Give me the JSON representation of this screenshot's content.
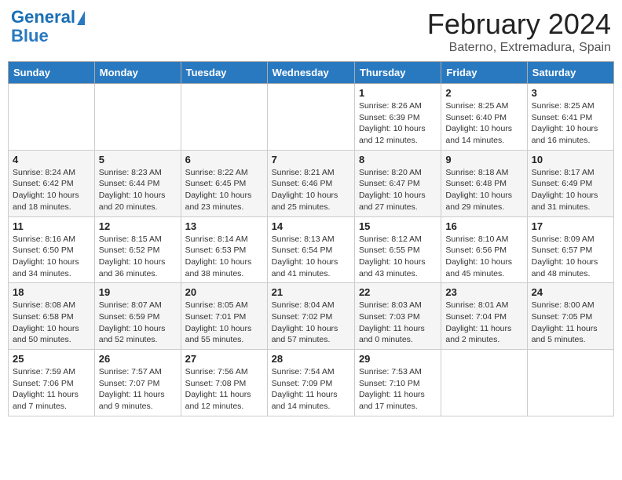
{
  "header": {
    "logo_line1": "General",
    "logo_line2": "Blue",
    "title": "February 2024",
    "subtitle": "Baterno, Extremadura, Spain"
  },
  "weekdays": [
    "Sunday",
    "Monday",
    "Tuesday",
    "Wednesday",
    "Thursday",
    "Friday",
    "Saturday"
  ],
  "weeks": [
    [
      {
        "day": "",
        "info": ""
      },
      {
        "day": "",
        "info": ""
      },
      {
        "day": "",
        "info": ""
      },
      {
        "day": "",
        "info": ""
      },
      {
        "day": "1",
        "info": "Sunrise: 8:26 AM\nSunset: 6:39 PM\nDaylight: 10 hours\nand 12 minutes."
      },
      {
        "day": "2",
        "info": "Sunrise: 8:25 AM\nSunset: 6:40 PM\nDaylight: 10 hours\nand 14 minutes."
      },
      {
        "day": "3",
        "info": "Sunrise: 8:25 AM\nSunset: 6:41 PM\nDaylight: 10 hours\nand 16 minutes."
      }
    ],
    [
      {
        "day": "4",
        "info": "Sunrise: 8:24 AM\nSunset: 6:42 PM\nDaylight: 10 hours\nand 18 minutes."
      },
      {
        "day": "5",
        "info": "Sunrise: 8:23 AM\nSunset: 6:44 PM\nDaylight: 10 hours\nand 20 minutes."
      },
      {
        "day": "6",
        "info": "Sunrise: 8:22 AM\nSunset: 6:45 PM\nDaylight: 10 hours\nand 23 minutes."
      },
      {
        "day": "7",
        "info": "Sunrise: 8:21 AM\nSunset: 6:46 PM\nDaylight: 10 hours\nand 25 minutes."
      },
      {
        "day": "8",
        "info": "Sunrise: 8:20 AM\nSunset: 6:47 PM\nDaylight: 10 hours\nand 27 minutes."
      },
      {
        "day": "9",
        "info": "Sunrise: 8:18 AM\nSunset: 6:48 PM\nDaylight: 10 hours\nand 29 minutes."
      },
      {
        "day": "10",
        "info": "Sunrise: 8:17 AM\nSunset: 6:49 PM\nDaylight: 10 hours\nand 31 minutes."
      }
    ],
    [
      {
        "day": "11",
        "info": "Sunrise: 8:16 AM\nSunset: 6:50 PM\nDaylight: 10 hours\nand 34 minutes."
      },
      {
        "day": "12",
        "info": "Sunrise: 8:15 AM\nSunset: 6:52 PM\nDaylight: 10 hours\nand 36 minutes."
      },
      {
        "day": "13",
        "info": "Sunrise: 8:14 AM\nSunset: 6:53 PM\nDaylight: 10 hours\nand 38 minutes."
      },
      {
        "day": "14",
        "info": "Sunrise: 8:13 AM\nSunset: 6:54 PM\nDaylight: 10 hours\nand 41 minutes."
      },
      {
        "day": "15",
        "info": "Sunrise: 8:12 AM\nSunset: 6:55 PM\nDaylight: 10 hours\nand 43 minutes."
      },
      {
        "day": "16",
        "info": "Sunrise: 8:10 AM\nSunset: 6:56 PM\nDaylight: 10 hours\nand 45 minutes."
      },
      {
        "day": "17",
        "info": "Sunrise: 8:09 AM\nSunset: 6:57 PM\nDaylight: 10 hours\nand 48 minutes."
      }
    ],
    [
      {
        "day": "18",
        "info": "Sunrise: 8:08 AM\nSunset: 6:58 PM\nDaylight: 10 hours\nand 50 minutes."
      },
      {
        "day": "19",
        "info": "Sunrise: 8:07 AM\nSunset: 6:59 PM\nDaylight: 10 hours\nand 52 minutes."
      },
      {
        "day": "20",
        "info": "Sunrise: 8:05 AM\nSunset: 7:01 PM\nDaylight: 10 hours\nand 55 minutes."
      },
      {
        "day": "21",
        "info": "Sunrise: 8:04 AM\nSunset: 7:02 PM\nDaylight: 10 hours\nand 57 minutes."
      },
      {
        "day": "22",
        "info": "Sunrise: 8:03 AM\nSunset: 7:03 PM\nDaylight: 11 hours\nand 0 minutes."
      },
      {
        "day": "23",
        "info": "Sunrise: 8:01 AM\nSunset: 7:04 PM\nDaylight: 11 hours\nand 2 minutes."
      },
      {
        "day": "24",
        "info": "Sunrise: 8:00 AM\nSunset: 7:05 PM\nDaylight: 11 hours\nand 5 minutes."
      }
    ],
    [
      {
        "day": "25",
        "info": "Sunrise: 7:59 AM\nSunset: 7:06 PM\nDaylight: 11 hours\nand 7 minutes."
      },
      {
        "day": "26",
        "info": "Sunrise: 7:57 AM\nSunset: 7:07 PM\nDaylight: 11 hours\nand 9 minutes."
      },
      {
        "day": "27",
        "info": "Sunrise: 7:56 AM\nSunset: 7:08 PM\nDaylight: 11 hours\nand 12 minutes."
      },
      {
        "day": "28",
        "info": "Sunrise: 7:54 AM\nSunset: 7:09 PM\nDaylight: 11 hours\nand 14 minutes."
      },
      {
        "day": "29",
        "info": "Sunrise: 7:53 AM\nSunset: 7:10 PM\nDaylight: 11 hours\nand 17 minutes."
      },
      {
        "day": "",
        "info": ""
      },
      {
        "day": "",
        "info": ""
      }
    ]
  ]
}
